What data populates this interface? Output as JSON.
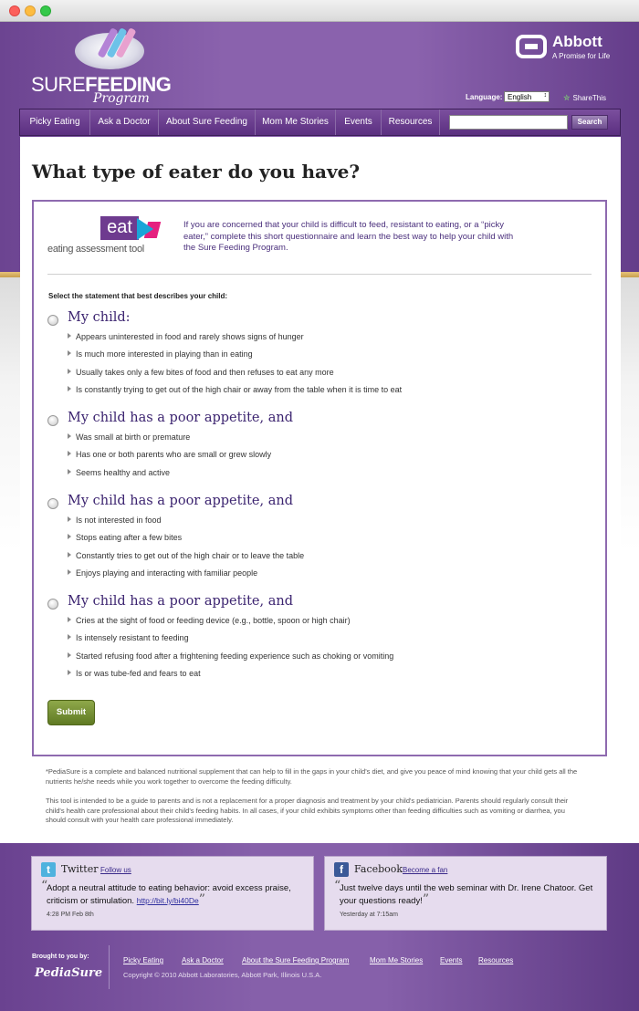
{
  "header": {
    "logo_title_light": "SURE",
    "logo_title_bold": "FEEDING",
    "logo_subtitle": "Program",
    "brand_name": "Abbott",
    "brand_tagline": "A Promise for Life",
    "language_label": "Language:",
    "language_value": "English",
    "share_label": "ShareThis"
  },
  "nav": {
    "items": [
      "Picky Eating",
      "Ask a Doctor",
      "About Sure Feeding",
      "Mom Me Stories",
      "Events",
      "Resources"
    ],
    "search_button": "Search",
    "search_value": ""
  },
  "page": {
    "title": "What type of eater do you have?"
  },
  "quiz": {
    "logo_word": "eat",
    "logo_caption": "eating assessment tool",
    "intro": "If you are concerned that your child is difficult to feed, resistant to eating, or a “picky eater,” complete this short questionnaire and learn the best way to help your child with the Sure Feeding Program.",
    "instruction": "Select the statement that best describes your child:",
    "options": [
      {
        "heading": "My child:",
        "items": [
          "Appears uninterested in food and rarely shows signs of hunger",
          "Is much more interested in playing than in eating",
          "Usually takes only a few bites of food and then refuses to eat any more",
          "Is constantly trying to get out of the high chair or away from the table when it is time to eat"
        ]
      },
      {
        "heading": "My child has a poor appetite, and",
        "items": [
          "Was small at birth or premature",
          "Has one or both parents who are small or grew slowly",
          "Seems healthy and active"
        ]
      },
      {
        "heading": "My child has a poor appetite, and",
        "items": [
          "Is not interested in food",
          "Stops eating after a few bites",
          "Constantly tries to get out of the high chair or to leave the table",
          "Enjoys playing and interacting with familiar people"
        ]
      },
      {
        "heading": "My child has a poor appetite, and",
        "items": [
          "Cries at the sight of food or feeding device (e.g., bottle, spoon or high chair)",
          "Is intensely resistant to feeding",
          "Started refusing food after a frightening feeding experience such as choking or vomiting",
          "Is or was tube-fed and fears to eat"
        ]
      }
    ],
    "submit_label": "Submit"
  },
  "footnotes": {
    "note1": "*PediaSure is a complete and balanced nutritional supplement that can help to fill in the gaps in your child's diet, and give you peace of mind knowing that your child gets all the nutrients he/she needs while you work together to overcome the feeding difficulty.",
    "note2": "This tool is intended to be a guide to parents and is not a replacement for a proper diagnosis and treatment by your child's pediatrician.  Parents should regularly consult their child's health care professional about their child's feeding habits.  In all cases, if your child exhibits symptoms other than feeding difficulties such as vomiting or diarrhea, you should consult with your health care professional immediately."
  },
  "social": {
    "twitter": {
      "title": "Twitter",
      "link": "Follow us",
      "quote": "Adopt a neutral attitude to eating behavior: avoid excess praise, criticism or stimulation.",
      "url": "http://bit.ly/bi40De",
      "time": "4:28 PM Feb 8th"
    },
    "facebook": {
      "title": "Facebook",
      "link": "Become a fan",
      "quote": "Just twelve days until the web seminar with Dr. Irene Chatoor.  Get your questions ready!",
      "time": "Yesterday at 7:15am"
    }
  },
  "footer": {
    "brought_by": "Brought to you by:",
    "sponsor": "PediaSure",
    "links": [
      "Picky Eating",
      "Ask a Doctor",
      "About the Sure Feeding Program",
      "Mom Me Stories",
      "Events",
      "Resources"
    ],
    "copyright": "Copyright © 2010 Abbott Laboratories, Abbott Park, Illinois U.S.A."
  },
  "colors": {
    "brand_purple": "#7a52a0",
    "heading_purple": "#3c2470",
    "submit_green": "#6f8a2e",
    "accent_gold": "#d8b260"
  }
}
